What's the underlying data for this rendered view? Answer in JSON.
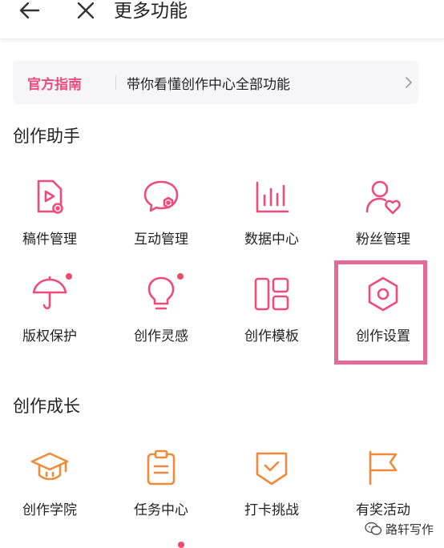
{
  "header": {
    "title": "更多功能"
  },
  "guide": {
    "tag": "官方指南",
    "text": "带你看懂创作中心全部功能"
  },
  "sections": [
    {
      "title": "创作助手"
    },
    {
      "title": "创作成长"
    }
  ],
  "tools": [
    {
      "label": "稿件管理",
      "icon": "draft-file-icon",
      "color": "#ee4b7c",
      "dot": false
    },
    {
      "label": "互动管理",
      "icon": "chat-bubble-icon",
      "color": "#ee4b7c",
      "dot": false
    },
    {
      "label": "数据中心",
      "icon": "bar-chart-icon",
      "color": "#ee4b7c",
      "dot": false
    },
    {
      "label": "粉丝管理",
      "icon": "fan-user-heart-icon",
      "color": "#ee4b7c",
      "dot": false
    },
    {
      "label": "版权保护",
      "icon": "umbrella-icon",
      "color": "#ee4b7c",
      "dot": true
    },
    {
      "label": "创作灵感",
      "icon": "lightbulb-icon",
      "color": "#ee4b7c",
      "dot": true
    },
    {
      "label": "创作模板",
      "icon": "template-grid-icon",
      "color": "#ee4b7c",
      "dot": false
    },
    {
      "label": "创作设置",
      "icon": "hexagon-settings-icon",
      "color": "#ee4b7c",
      "dot": false,
      "highlighted": true
    },
    {
      "label": "创作学院",
      "icon": "graduation-cap-icon",
      "color": "#f08a3a",
      "dot": false
    },
    {
      "label": "任务中心",
      "icon": "clipboard-task-icon",
      "color": "#f08a3a",
      "dot": false
    },
    {
      "label": "打卡挑战",
      "icon": "check-badge-icon",
      "color": "#f08a3a",
      "dot": false
    },
    {
      "label": "有奖活动",
      "icon": "flag-icon",
      "color": "#f08a3a",
      "dot": false
    }
  ],
  "watermark": {
    "text": "路轩写作",
    "icon": "wechat-icon"
  }
}
